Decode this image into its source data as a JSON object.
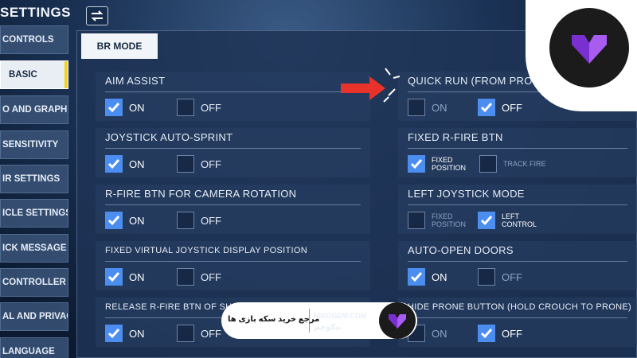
{
  "header": {
    "title": "SETTINGS",
    "swap_icon": "swap-arrows-icon"
  },
  "sidebar": {
    "items": [
      {
        "label": "CONTROLS"
      },
      {
        "label": "BASIC"
      },
      {
        "label": "O AND GRAPHICS"
      },
      {
        "label": "SENSITIVITY"
      },
      {
        "label": "IR SETTINGS"
      },
      {
        "label": "ICLE SETTINGS"
      },
      {
        "label": "ICK MESSAGE"
      },
      {
        "label": "CONTROLLER"
      },
      {
        "label": "AL AND PRIVACY"
      },
      {
        "label": "LANGUAGE"
      }
    ],
    "active_index": 1
  },
  "mode_tab": {
    "label": "BR MODE"
  },
  "settings": {
    "aim_assist": {
      "title": "AIM ASSIST",
      "on": "ON",
      "off": "OFF",
      "selected": "ON"
    },
    "joystick_sprint": {
      "title": "JOYSTICK AUTO-SPRINT",
      "on": "ON",
      "off": "OFF",
      "selected": "ON"
    },
    "rfire_camera": {
      "title": "R-FIRE BTN FOR CAMERA ROTATION",
      "on": "ON",
      "off": "OFF",
      "selected": "ON"
    },
    "fixed_joystick": {
      "title": "FIXED VIRTUAL JOYSTICK DISPLAY POSITION",
      "on": "ON",
      "off": "OFF",
      "selected": "ON"
    },
    "release_rfire": {
      "title": "RELEASE R-FIRE BTN OF SHOTGUN TO HIP FIRE",
      "on": "ON",
      "off": "OFF",
      "selected": "ON"
    },
    "quick_run": {
      "title": "QUICK RUN (FROM PRONE)",
      "on": "ON",
      "off": "OFF",
      "selected": "OFF"
    },
    "fixed_rfire": {
      "title": "FIXED R-FIRE BTN",
      "opt1": "FIXED POSITION",
      "opt2": "TRACK FIRE",
      "selected": "FIXED POSITION"
    },
    "left_joystick": {
      "title": "LEFT JOYSTICK MODE",
      "opt1": "FIXED POSITION",
      "opt2": "LEFT CONTROL",
      "selected": "LEFT CONTROL"
    },
    "auto_doors": {
      "title": "AUTO-OPEN DOORS",
      "on": "ON",
      "off": "OFF",
      "selected": "ON"
    },
    "hide_prone": {
      "title": "HIDE PRONE BUTTON (HOLD CROUCH TO PRONE)",
      "on": "ON",
      "off": "OFF",
      "selected": "OFF"
    }
  },
  "watermark": {
    "url": "NIKOGEM.COM",
    "tagline": "مرجع خرید سکه بازی ها",
    "name": "نیکوجم"
  },
  "colors": {
    "accent": "#4b8ef0",
    "active_tab_marker": "#f4d21a",
    "arrow": "#e8322a",
    "logo_purple": "#7a2fd0"
  }
}
